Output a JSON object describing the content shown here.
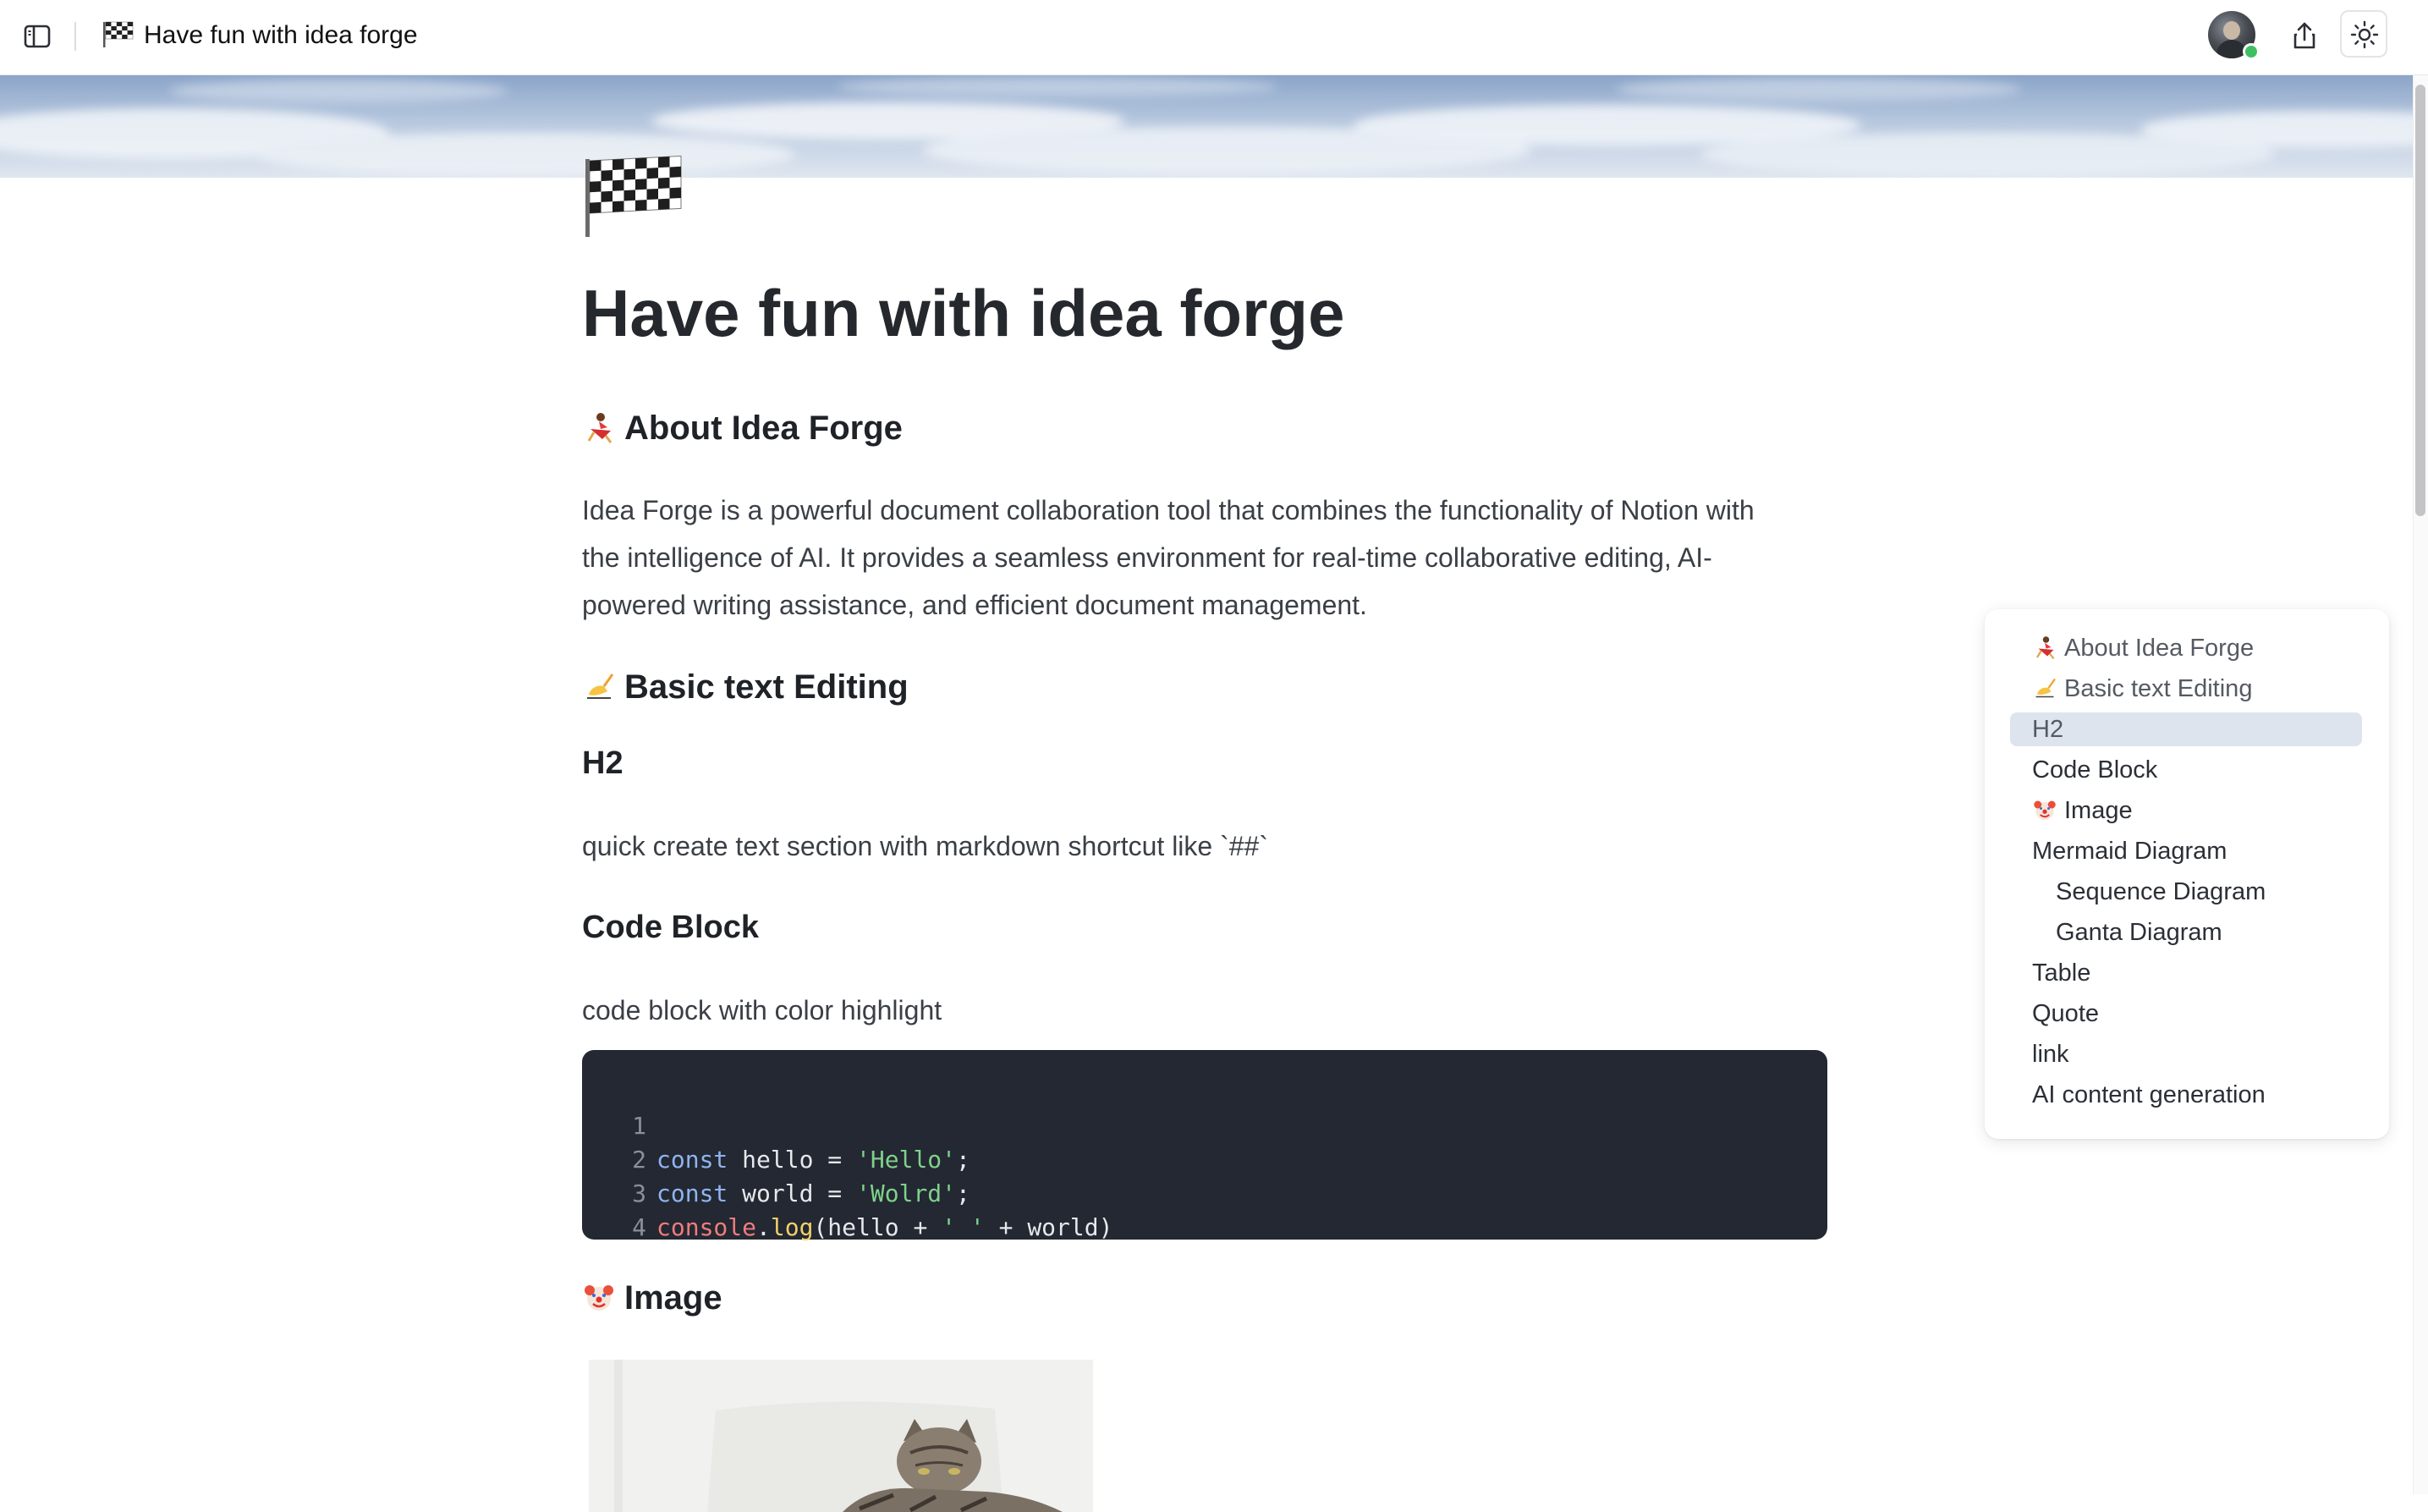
{
  "topbar": {
    "doc_title": "Have fun with idea forge"
  },
  "document": {
    "title": "Have fun with idea forge",
    "sections": {
      "about_heading": "About Idea Forge",
      "about_body_line1": "Idea Forge is a powerful document collaboration tool that combines the functionality of Notion with",
      "about_body_line2": "the intelligence of AI. It provides a seamless environment for real-time collaborative editing, AI-",
      "about_body_line3": "powered writing assistance, and efficient document management.",
      "basic_heading": "Basic text Editing",
      "h2_heading": "H2",
      "h2_body": "quick create text section with markdown shortcut like `##`",
      "code_heading": "Code Block",
      "code_body": "code block with  color  highlight",
      "image_heading": "Image"
    },
    "code": {
      "line_numbers": [
        "1",
        "2",
        "3",
        "4"
      ],
      "lines": [
        {
          "kw": "const",
          "rest1": " hello = ",
          "str": "'Hello'",
          "rest2": ";"
        },
        {
          "kw": "const",
          "rest1": " world = ",
          "str": "'Wolrd'",
          "rest2": ";"
        },
        {
          "obj": "console",
          "dot": ".",
          "fn": "log",
          "a": "(hello + ",
          "str": "' '",
          "b": " + world)"
        }
      ]
    }
  },
  "toc": {
    "items": [
      {
        "label": "About Idea Forge"
      },
      {
        "label": "Basic text Editing"
      },
      {
        "label": "H2"
      },
      {
        "label": "Code Block"
      },
      {
        "label": "Image"
      },
      {
        "label": "Mermaid Diagram"
      },
      {
        "label": "Sequence Diagram"
      },
      {
        "label": "Ganta Diagram"
      },
      {
        "label": "Table"
      },
      {
        "label": "Quote"
      },
      {
        "label": "link"
      },
      {
        "label": "AI content generation"
      }
    ],
    "active": "H2"
  },
  "icons": {
    "sidebar_toggle": "sidebar-toggle-icon",
    "share": "share-icon",
    "theme": "sun-icon",
    "flag": "checkered-flag-icon",
    "about": "dancer-emoji-icon",
    "basic": "writing-hand-emoji-icon",
    "image": "clown-emoji-icon"
  },
  "colors": {
    "code_bg": "#232832",
    "keyword": "#8fb4f0",
    "string": "#7fd18b",
    "toc_active": "#dde4ee",
    "online": "#3fbf62"
  }
}
